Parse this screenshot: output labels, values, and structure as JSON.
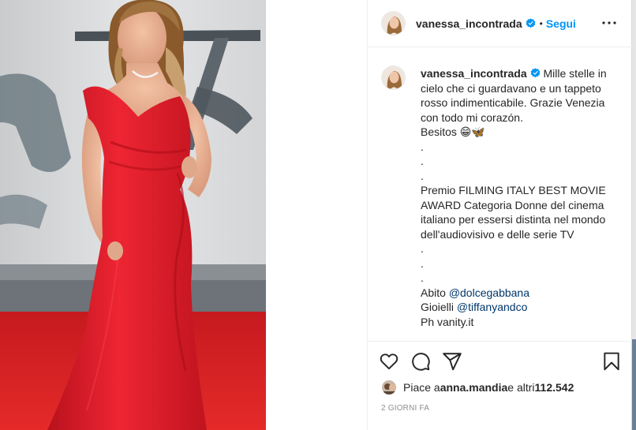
{
  "post": {
    "username": "vanessa_incontrada",
    "follow_separator": "•",
    "follow_label": "Segui",
    "caption": [
      "Mille stelle in",
      "cielo che ci guardavano e un tappeto",
      "rosso indimenticabile. Grazie Venezia",
      "con todo mi corazón.",
      "Besitos 😁🦋",
      ".",
      ".",
      ".",
      "Premio FILMING ITALY BEST MOVIE",
      "AWARD Categoria Donne del cinema",
      "italiano per essersi distinta nel mondo",
      "dell'audiovisivo e delle serie TV",
      ".",
      ".",
      "."
    ],
    "credits": [
      {
        "prefix": "Abito ",
        "mention": "@dolcegabbana"
      },
      {
        "prefix": "Gioielli ",
        "mention": "@tiffanyandco"
      },
      {
        "prefix": "Ph vanity.it",
        "mention": ""
      }
    ],
    "likes_prefix": "Piace a ",
    "likes_user": "anna.mandia",
    "likes_mid": " e altri ",
    "likes_count": "112.542",
    "timestamp": "2 GIORNI FA"
  },
  "icons": {
    "verified": "verified-badge-icon",
    "more": "more-options-icon",
    "like": "heart-icon",
    "comment": "comment-icon",
    "share": "paper-plane-icon",
    "save": "bookmark-icon"
  },
  "colors": {
    "link": "#0095f6",
    "mention": "#00376b",
    "dress": "#e8212f",
    "carpet": "#e01e22"
  }
}
